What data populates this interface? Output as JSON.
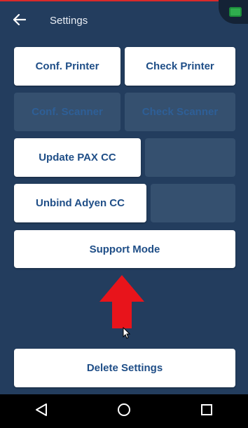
{
  "header": {
    "title": "Settings",
    "back_icon": "arrow-left-icon",
    "status_icon": "green-indicator-icon"
  },
  "buttons": {
    "conf_printer": "Conf. Printer",
    "check_printer": "Check Printer",
    "conf_scanner": "Conf. Scanner",
    "check_scanner": "Check Scanner",
    "update_pax_cc": "Update PAX CC",
    "unbind_adyen_cc": "Unbind Adyen CC",
    "support_mode": "Support Mode",
    "delete_settings": "Delete Settings"
  },
  "colors": {
    "background": "#233d5e",
    "button_text": "#1f4e87",
    "arrow": "#e8141b"
  },
  "navbar": {
    "icons": [
      "back-triangle-icon",
      "home-circle-icon",
      "recents-square-icon"
    ]
  }
}
